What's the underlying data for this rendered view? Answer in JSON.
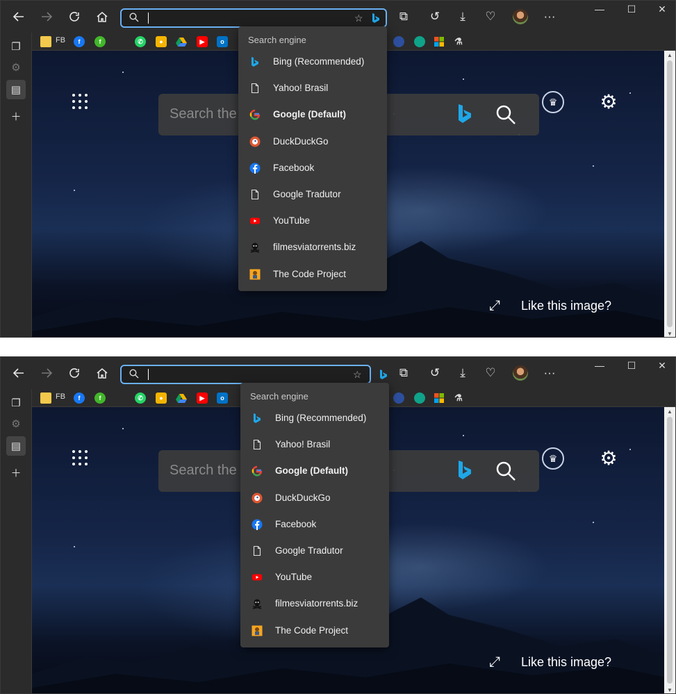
{
  "colors": {
    "accent": "#6ab0f3",
    "toolbar_bg": "#2b2b2b",
    "dropdown_bg": "#3b3b3b",
    "facebook_blue": "#1877f2",
    "youtube_red": "#ff0000",
    "duckduckgo_orange": "#de5833",
    "bing_blue": "#1ea7e8"
  },
  "favorites": {
    "fb_label": "FB"
  },
  "newtab": {
    "search_placeholder": "Search the web",
    "like_text": "Like this image?"
  },
  "dropdown": {
    "header": "Search engine",
    "items": [
      {
        "label": "Bing (Recommended)",
        "icon": "bing-icon",
        "bold": false
      },
      {
        "label": "Yahoo! Brasil",
        "icon": "page-icon",
        "bold": false
      },
      {
        "label": "Google (Default)",
        "icon": "google-icon",
        "bold": true
      },
      {
        "label": "DuckDuckGo",
        "icon": "duckduckgo-icon",
        "bold": false
      },
      {
        "label": "Facebook",
        "icon": "facebook-icon",
        "bold": false
      },
      {
        "label": "Google Tradutor",
        "icon": "page-icon",
        "bold": false
      },
      {
        "label": "YouTube",
        "icon": "youtube-icon",
        "bold": false
      },
      {
        "label": "filmesviatorrents.biz",
        "icon": "skull-icon",
        "bold": false
      },
      {
        "label": "The Code Project",
        "icon": "codeproject-icon",
        "bold": false
      }
    ]
  }
}
